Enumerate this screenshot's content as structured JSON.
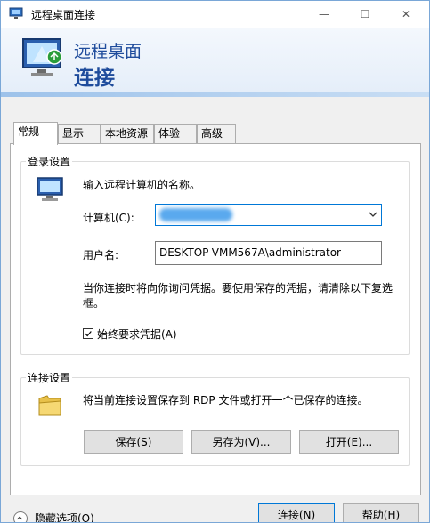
{
  "window": {
    "title": "远程桌面连接",
    "controls": {
      "minimize": "—",
      "maximize": "☐",
      "close": "✕"
    }
  },
  "banner": {
    "line1": "远程桌面",
    "line2": "连接"
  },
  "tabs": [
    {
      "label": "常规",
      "active": true
    },
    {
      "label": "显示",
      "active": false
    },
    {
      "label": "本地资源",
      "active": false
    },
    {
      "label": "体验",
      "active": false
    },
    {
      "label": "高级",
      "active": false
    }
  ],
  "login": {
    "group_label": "登录设置",
    "prompt": "输入远程计算机的名称。",
    "computer_label": "计算机(C):",
    "computer_value": "",
    "username_label": "用户名:",
    "username_value": "DESKTOP-VMM567A\\administrator",
    "note": "当你连接时将向你询问凭据。要使用保存的凭据，请清除以下复选框。",
    "always_ask_label": "始终要求凭据(A)",
    "always_ask_checked": true
  },
  "connection": {
    "group_label": "连接设置",
    "description": "将当前连接设置保存到 RDP 文件或打开一个已保存的连接。",
    "save_label": "保存(S)",
    "save_as_label": "另存为(V)...",
    "open_label": "打开(E)..."
  },
  "footer": {
    "hide_options_label": "隐藏选项(O)",
    "connect_label": "连接(N)",
    "help_label": "帮助(H)"
  },
  "colors": {
    "accent": "#0078d7",
    "banner_text": "#1f4c9c"
  }
}
